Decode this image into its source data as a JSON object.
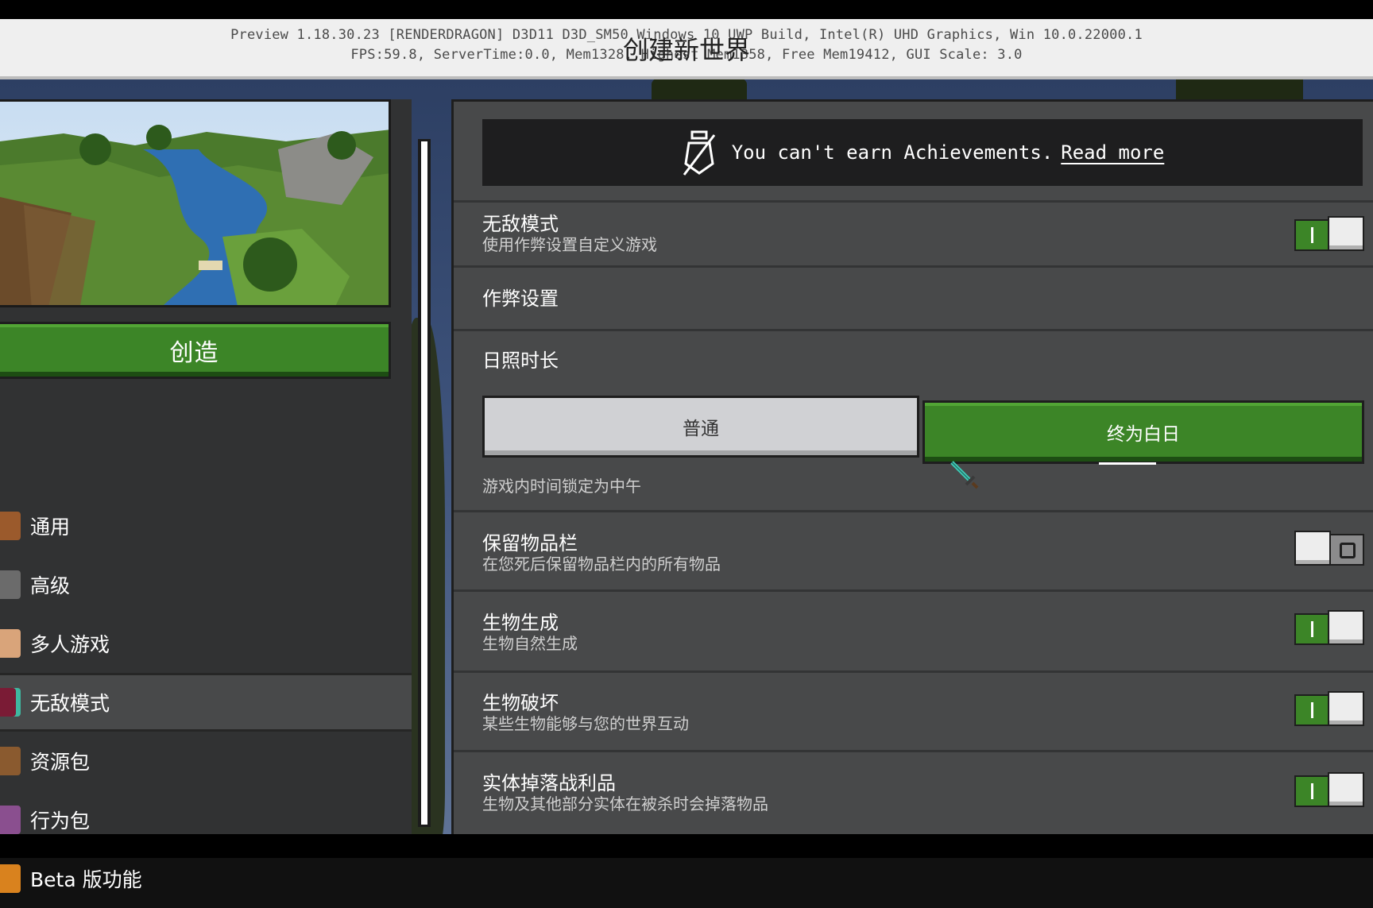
{
  "debug": {
    "line1": "Preview 1.18.30.23 [RENDERDRAGON] D3D11 D3D_SM50 Windows 10 UWP Build, Intel(R) UHD Graphics, Win 10.0.22000.1",
    "line2": "FPS:59.8, ServerTime:0.0, Mem1328, Highest Mem1358, Free Mem19412, GUI Scale: 3.0"
  },
  "page_title": "创建新世界",
  "left": {
    "create_label": "创造",
    "nav": [
      {
        "label": "通用",
        "icon": "gear-icon",
        "color": "#9b5a2c"
      },
      {
        "label": "高级",
        "icon": "anvil-icon",
        "color": "#6b6b6b"
      },
      {
        "label": "多人游戏",
        "icon": "player-icon",
        "color": "#d9a47a"
      },
      {
        "label": "无敌模式",
        "icon": "cheats-icon",
        "color": "#7a1b35"
      },
      {
        "label": "资源包",
        "icon": "resource-pack-icon",
        "color": "#8a5a2f"
      },
      {
        "label": "行为包",
        "icon": "behavior-pack-icon",
        "color": "#8a4f8f"
      },
      {
        "label": "Beta 版功能",
        "icon": "beta-icon",
        "color": "#d9821e"
      }
    ],
    "selected_index": 3
  },
  "right": {
    "banner": {
      "text": "You can't earn Achievements.",
      "link": "Read more",
      "icon": "no-achievement-icon"
    },
    "cheats": {
      "title": "无敌模式",
      "desc": "使用作弊设置自定义游戏",
      "on": true
    },
    "cheat_settings_heading": "作弊设置",
    "daylight": {
      "title": "日照时长",
      "options": [
        "普通",
        "终为白日"
      ],
      "selected": "终为白日",
      "desc": "游戏内时间锁定为中午"
    },
    "keep_inventory": {
      "title": "保留物品栏",
      "desc": "在您死后保留物品栏内的所有物品",
      "on": false
    },
    "mob_spawning": {
      "title": "生物生成",
      "desc": "生物自然生成",
      "on": true
    },
    "mob_griefing": {
      "title": "生物破坏",
      "desc": "某些生物能够与您的世界互动",
      "on": true
    },
    "entity_drops": {
      "title": "实体掉落战利品",
      "desc": "生物及其他部分实体在被杀时会掉落物品",
      "on": true
    }
  },
  "colors": {
    "accent_green": "#3c8527",
    "panel_dark": "#313233",
    "panel": "#48494a"
  }
}
